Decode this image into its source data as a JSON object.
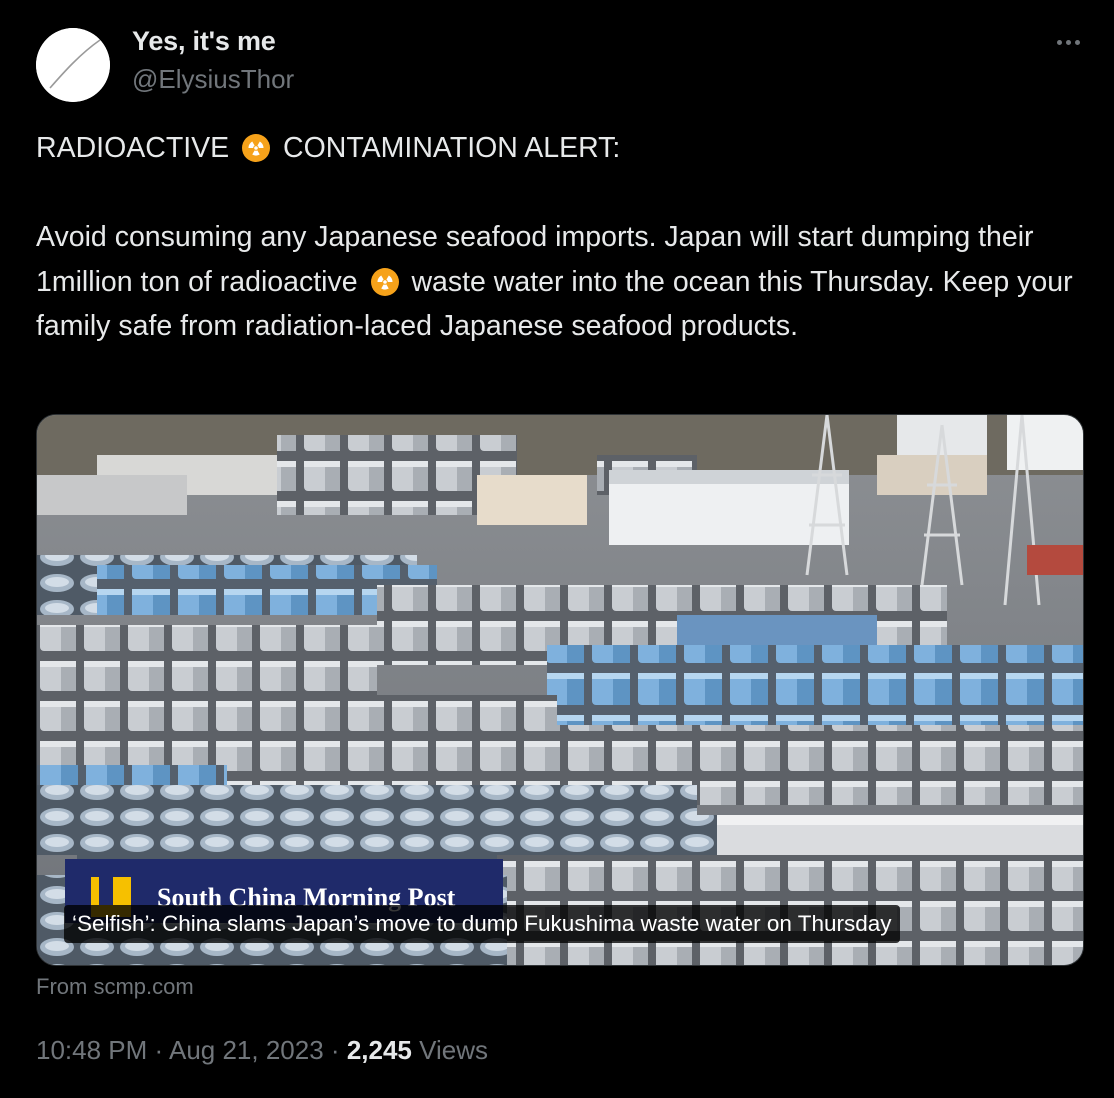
{
  "author": {
    "display_name": "Yes, it's me",
    "handle": "@ElysiusThor"
  },
  "icons": {
    "more": "more-horizontal-icon",
    "radioactive": "radioactive-emoji-icon",
    "avatar": "avatar-slash-icon"
  },
  "tweet": {
    "line1_before": "RADIOACTIVE",
    "line1_after": "CONTAMINATION ALERT:",
    "body_part1": "Avoid consuming any Japanese seafood imports. Japan will start dumping their 1million ton of radioactive",
    "body_part2": "waste water into the ocean this Thursday. Keep your family safe from radiation-laced Japanese seafood products."
  },
  "card": {
    "logo_text": "South China Morning Post",
    "title": "‘Selfish’: China slams Japan’s move to dump Fukushima waste water on Thursday",
    "source": "From scmp.com"
  },
  "meta": {
    "time": "10:48 PM",
    "date": "Aug 21, 2023",
    "views_count": "2,245",
    "views_label": "Views"
  },
  "colors": {
    "background": "#000000",
    "text_primary": "#e7e9ea",
    "text_secondary": "#71767b",
    "emoji_orange": "#f6a21a"
  }
}
